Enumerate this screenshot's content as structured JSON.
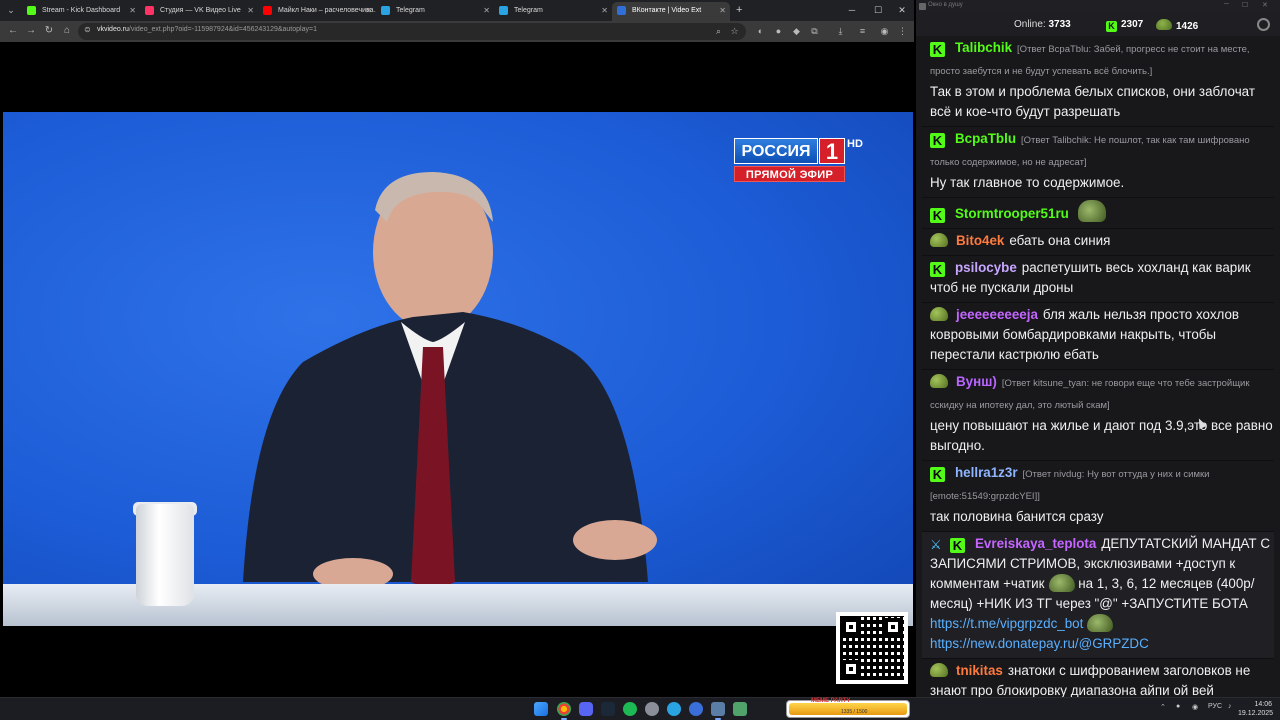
{
  "browser": {
    "tabs": [
      {
        "label": "Stream - Kick Dashboard",
        "favicon_color": "#53fc18"
      },
      {
        "label": "Студия — VK Видео Live",
        "favicon_color": "#ff3366"
      },
      {
        "label": "Майкл Наки – расчеловечива…",
        "favicon_color": "#ff0000"
      },
      {
        "label": "Telegram",
        "favicon_color": "#2aa3e3"
      },
      {
        "label": "Telegram",
        "favicon_color": "#2aa3e3"
      },
      {
        "label": "ВКонтакте | Video Ext",
        "favicon_color": "#2f6fd8",
        "active": true
      }
    ],
    "url_host": "vkvideo.ru",
    "url_path": "/video_ext.php?oid=-115987924&id=456243129&autoplay=1"
  },
  "video": {
    "channel_logo": "РОССИЯ",
    "channel_number": "1",
    "hd_label": "HD",
    "live_label": "ПРЯМОЙ ЭФИР"
  },
  "chat": {
    "window_title": "Окно в душу",
    "online_label": "Online:",
    "online_count": "3733",
    "kick_count": "2307",
    "vk_count": "1426",
    "messages": [
      {
        "badge": "kick",
        "user": "Talibchik",
        "color": "#53fc18",
        "reply": "[Ответ ВсраТblu: Забей, прогресс не стоит на месте, просто заебутся и не будут успевать всё блочить.]",
        "text": "Так в этом и проблема белых списков, они заблочат всё и кое-что будут разрешать"
      },
      {
        "badge": "kick",
        "user": "ВсраТblu",
        "color": "#53fc18",
        "reply": "[Ответ Talibchik: Не пошлот, так как там шифровано только содержимое, но не адресат]",
        "text": "Ну так главное то содержимое."
      },
      {
        "badge": "kick",
        "user": "Stormtrooper51ru",
        "color": "#53fc18",
        "reply": "",
        "text": "",
        "emote": "stormtrooper-emote"
      },
      {
        "badge": "vk",
        "user": "Bito4ek",
        "color": "#ff7a3d",
        "reply": "",
        "text": "ебать она синия"
      },
      {
        "badge": "kick",
        "user": "psilocybe",
        "color": "#c7a6ff",
        "reply": "",
        "text": "распетушить весь хохланд как варик чтоб не пускали дроны"
      },
      {
        "badge": "vk",
        "user": "jeeeeeeeeeja",
        "color": "#c466ff",
        "reply": "",
        "text": "бля жаль нельзя просто хохлов ковровыми бомбардировками накрыть, чтобы перестали кастрюлю ебать"
      },
      {
        "badge": "vk",
        "user": "Вунш)",
        "color": "#b866ff",
        "reply": "[Ответ kitsune_tyan: не говори еще что тебе застройщик сскидку на ипотеку дал, это лютый скам]",
        "text": "цену повышают на жилье и дают под 3.9,это все равно выгодно."
      },
      {
        "badge": "kick",
        "user": "hellra1z3r",
        "color": "#8fb4ff",
        "reply": "[Ответ nivdug: Ну вот оттуда у них и симки [emote:51549:grpzdcYEI]]",
        "text": "так половина банится сразу"
      },
      {
        "badge": "kick",
        "user": "Evreiskaya_teplota",
        "color": "#c466ff",
        "reply": "",
        "text_a": "ДЕПУТАТСКИЙ МАНДАТ С ЗАПИСЯМИ СТРИМОВ, эксклюзивами +доступ к комментам +чатик",
        "text_b": "на 1, 3, 6, 12 месяцев (400р/месяц) +НИК ИЗ ТГ через \"@\" +ЗАПУСТИТЕ БОТА",
        "link1": "https://t.me/vipgrpzdc_bot",
        "link2": "https://new.donatepay.ru/@GRPZDC",
        "highlight": true
      },
      {
        "badge": "vk",
        "user": "tnikitas",
        "color": "#ff7a3d",
        "reply": "",
        "text": "знатоки с шифрованием заголовков не знают про блокировку диапазона айпи ой вей"
      }
    ]
  },
  "taskbar": {
    "widget_label": "MEME PARTY",
    "widget_value": "1335 / 1500",
    "lang": "РУС",
    "time": "14:06",
    "date": "19.12.2025"
  }
}
